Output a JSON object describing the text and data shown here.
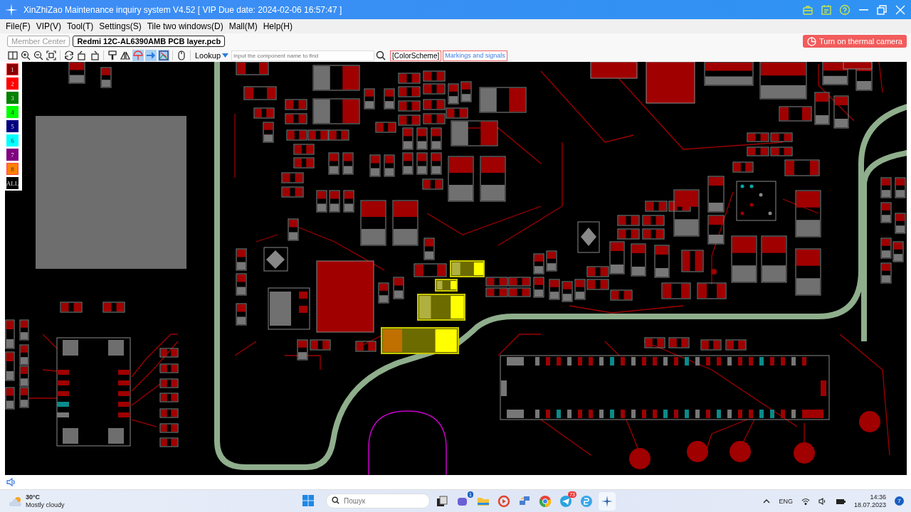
{
  "window": {
    "title": "XinZhiZao Maintenance inquiry system V4.52 [ VIP Due date: 2024-02-06 16:57:47 ]"
  },
  "title_bar_buttons": [
    {
      "kind": "briefcase"
    },
    {
      "kind": "calendar"
    },
    {
      "kind": "help"
    },
    {
      "kind": "minimize"
    },
    {
      "kind": "restore"
    },
    {
      "kind": "close"
    }
  ],
  "menu": [
    "File(F)",
    "VIP(V)",
    "Tool(T)",
    "Settings(S)",
    "Tile two windows(D)",
    "Mall(M)",
    "Help(H)"
  ],
  "tabs": [
    {
      "label": "Member Center",
      "selected": false
    },
    {
      "label": "Redmi 12C-AL6390AMB PCB layer.pcb",
      "selected": true
    }
  ],
  "thermal_button": {
    "label": "Turn on thermal camera"
  },
  "toolbar": [
    {
      "kind": "split",
      "active": false
    },
    {
      "kind": "zoom-in",
      "active": false
    },
    {
      "kind": "zoom-out",
      "active": false
    },
    {
      "kind": "fit",
      "active": false
    },
    {
      "kind": "refresh",
      "active": false
    },
    {
      "kind": "rotate-left",
      "active": false
    },
    {
      "kind": "rotate-right",
      "active": false
    },
    {
      "kind": "brush",
      "active": false
    },
    {
      "kind": "mirror",
      "active": false
    },
    {
      "kind": "probe",
      "active": true
    },
    {
      "kind": "pointer",
      "active": true
    },
    {
      "kind": "image",
      "active": true
    },
    {
      "kind": "mouse",
      "active": false
    }
  ],
  "lookup": {
    "label": "Lookup",
    "placeholder": "Input the component name to find"
  },
  "color_scheme_button": "[ColorScheme]",
  "markings_button": "Markings and signals",
  "layers": [
    {
      "label": "1",
      "color": "#8b0000",
      "selected": true
    },
    {
      "label": "2",
      "color": "#ff0000",
      "selected": false
    },
    {
      "label": "3",
      "color": "#008000",
      "selected": false
    },
    {
      "label": "4",
      "color": "#00ff00",
      "selected": false
    },
    {
      "label": "5",
      "color": "#000080",
      "selected": false
    },
    {
      "label": "6",
      "color": "#00ffff",
      "selected": false
    },
    {
      "label": "7",
      "color": "#800080",
      "selected": false
    },
    {
      "label": "8",
      "color": "#ff8000",
      "selected": true
    },
    {
      "label": "ALL",
      "color": "#000000",
      "selected": false
    }
  ],
  "taskbar": {
    "weather": {
      "temperature": "30°C",
      "condition": "Mostly cloudy"
    },
    "search": {
      "placeholder": "Пошук"
    },
    "apps": [
      {
        "kind": "taskview",
        "active": false
      },
      {
        "kind": "chat",
        "badge": "1",
        "active": false
      },
      {
        "kind": "folder",
        "active": false
      },
      {
        "kind": "media",
        "active": false
      },
      {
        "kind": "network",
        "active": false
      },
      {
        "kind": "chrome",
        "active": false
      },
      {
        "kind": "telegram",
        "badge": "73",
        "active": false
      },
      {
        "kind": "browser",
        "active": false
      },
      {
        "kind": "xinzhizao",
        "active": true
      }
    ],
    "language": "ENG",
    "time": "14:36",
    "date": "18.07.2023",
    "notifications": "7"
  }
}
